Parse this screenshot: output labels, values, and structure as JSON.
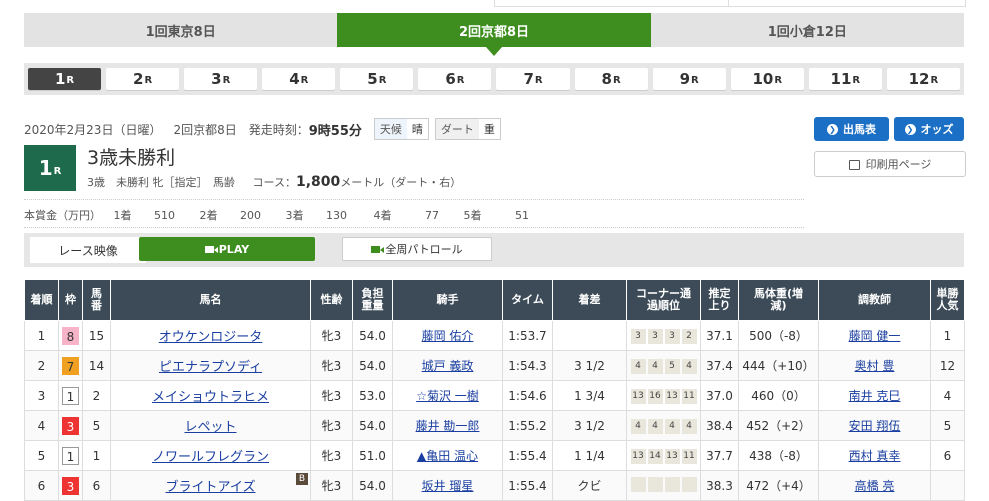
{
  "venues": [
    "1回東京8日",
    "2回京都8日",
    "1回小倉12日"
  ],
  "active_venue": 1,
  "races": [
    {
      "num": "1",
      "suffix": "R"
    },
    {
      "num": "2",
      "suffix": "R"
    },
    {
      "num": "3",
      "suffix": "R"
    },
    {
      "num": "4",
      "suffix": "R"
    },
    {
      "num": "5",
      "suffix": "R"
    },
    {
      "num": "6",
      "suffix": "R"
    },
    {
      "num": "7",
      "suffix": "R"
    },
    {
      "num": "8",
      "suffix": "R"
    },
    {
      "num": "9",
      "suffix": "R"
    },
    {
      "num": "10",
      "suffix": "R"
    },
    {
      "num": "11",
      "suffix": "R"
    },
    {
      "num": "12",
      "suffix": "R"
    }
  ],
  "race_info": {
    "date": "2020年2月23日（日曜）",
    "meeting": "2回京都8日",
    "start_label": "発走時刻：",
    "start_time": "9時55分",
    "weather_label": "天候",
    "weather": "晴",
    "track_label": "ダート",
    "track": "重"
  },
  "race": {
    "num": "1",
    "suffix": "R",
    "title": "3歳未勝利",
    "cond1": "3歳　未勝利 牝［指定］　馬齢",
    "course_label": "コース：",
    "distance": "1,800",
    "unit": "メートル",
    "course_detail": "（ダート・右）"
  },
  "buttons": {
    "shutsuba": "出馬表",
    "odds": "オッズ",
    "print": "印刷用ページ"
  },
  "prize": {
    "label": "本賞金（万円）",
    "items": [
      {
        "rank": "1着",
        "amount": "510"
      },
      {
        "rank": "2着",
        "amount": "200"
      },
      {
        "rank": "3着",
        "amount": "130"
      },
      {
        "rank": "4着",
        "amount": "77"
      },
      {
        "rank": "5着",
        "amount": "51"
      }
    ]
  },
  "video": {
    "label": "レース映像",
    "play": "PLAY",
    "patrol": "全周パトロール"
  },
  "table": {
    "headers": [
      "着順",
      "枠",
      "馬番",
      "馬名",
      "性齢",
      "負担重量",
      "騎手",
      "タイム",
      "着差",
      "コーナー通過順位",
      "推定上り",
      "馬体重(増減)",
      "調教師",
      "単勝人気"
    ],
    "rows": [
      {
        "pos": "1",
        "waku": "8",
        "num": "15",
        "name": "オウケンロジータ",
        "sex": "牝3",
        "wt": "54.0",
        "jockey": "藤岡 佑介",
        "time": "1:53.7",
        "margin": "",
        "corner": [
          "3",
          "3",
          "3",
          "2"
        ],
        "agari": "37.1",
        "bw": "500（-8）",
        "trainer": "藤岡 健一",
        "pop": "1"
      },
      {
        "pos": "2",
        "waku": "7",
        "num": "14",
        "name": "ピエナラプソディ",
        "sex": "牝3",
        "wt": "54.0",
        "jockey": "城戸 義政",
        "time": "1:54.3",
        "margin": "3 1/2",
        "corner": [
          "4",
          "4",
          "5",
          "4"
        ],
        "agari": "37.4",
        "bw": "444（+10）",
        "trainer": "奥村 豊",
        "pop": "12"
      },
      {
        "pos": "3",
        "waku": "1",
        "num": "2",
        "name": "メイショウトラヒメ",
        "sex": "牝3",
        "wt": "53.0",
        "jockey": "☆菊沢 一樹",
        "time": "1:54.6",
        "margin": "1 3/4",
        "corner": [
          "13",
          "16",
          "13",
          "11"
        ],
        "agari": "37.0",
        "bw": "460（0）",
        "trainer": "南井 克巳",
        "pop": "4"
      },
      {
        "pos": "4",
        "waku": "3",
        "num": "5",
        "name": "レペット",
        "sex": "牝3",
        "wt": "54.0",
        "jockey": "藤井 勘一郎",
        "time": "1:55.2",
        "margin": "3 1/2",
        "corner": [
          "4",
          "4",
          "4",
          "4"
        ],
        "agari": "38.4",
        "bw": "452（+2）",
        "trainer": "安田 翔伍",
        "pop": "5"
      },
      {
        "pos": "5",
        "waku": "1",
        "num": "1",
        "name": "ノワールフレグラン",
        "sex": "牝3",
        "wt": "51.0",
        "jockey": "▲亀田 温心",
        "time": "1:55.4",
        "margin": "1 1/4",
        "corner": [
          "13",
          "14",
          "13",
          "11"
        ],
        "agari": "37.7",
        "bw": "438（-8）",
        "trainer": "西村 真幸",
        "pop": "6"
      },
      {
        "pos": "6",
        "waku": "3",
        "num": "6",
        "name": "ブライトアイズ",
        "sex": "牝3",
        "wt": "54.0",
        "jockey": "坂井 瑠星",
        "time": "1:55.4",
        "margin": "クビ",
        "corner": [
          "",
          "",
          "",
          ""
        ],
        "agari": "38.3",
        "bw": "472（+4）",
        "trainer": "高橋 亮",
        "pop": ""
      }
    ]
  },
  "colors": {
    "venue_active": "#3e8e1f",
    "race_active": "#444444",
    "badge": "#1d6b4c",
    "blue_button": "#1b6fc4",
    "table_header": "#3c4b57",
    "link": "#1a3fa0"
  }
}
